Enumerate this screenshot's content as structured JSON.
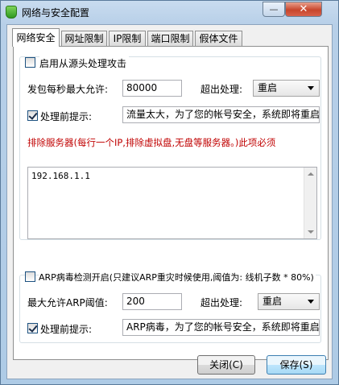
{
  "window": {
    "title": "网络与安全配置",
    "close_glyph": "✕",
    "min_glyph": "—"
  },
  "tabs": [
    {
      "label": "网络安全",
      "active": true
    },
    {
      "label": "网址限制"
    },
    {
      "label": "IP限制"
    },
    {
      "label": "端口限制"
    },
    {
      "label": "假体文件"
    }
  ],
  "source_group": {
    "enable_label": "启用从源头处理攻击",
    "enable_checked": false,
    "max_packets_label": "发包每秒最大允许:",
    "max_packets_value": "80000",
    "exceed_label": "超出处理:",
    "exceed_value": "重启",
    "prompt_label": "处理前提示:",
    "prompt_checked": true,
    "prompt_value": "流量太大，为了您的帐号安全，系统即将重启",
    "exclude_note": "排除服务器(每行一个IP,排除虚拟盘,无盘等服务器。)此项必须",
    "exclude_list": "192.168.1.1"
  },
  "arp_group": {
    "enable_label": "ARP病毒检测开启(只建议ARP重灾时候使用,阈值为: 线机子数 * 80%)",
    "enable_checked": false,
    "threshold_label": "最大允许ARP阈值:",
    "threshold_value": "200",
    "exceed_label": "超出处理:",
    "exceed_value": "重启",
    "prompt_label": "处理前提示:",
    "prompt_checked": true,
    "prompt_value": "ARP病毒，为了您的帐号安全，系统即将重启。"
  },
  "buttons": {
    "close": "关闭(C)",
    "save": "保存(S)"
  },
  "colors": {
    "accent": "#c00000",
    "title_bar": "#b7cfe8",
    "close_button": "#c8462c"
  }
}
